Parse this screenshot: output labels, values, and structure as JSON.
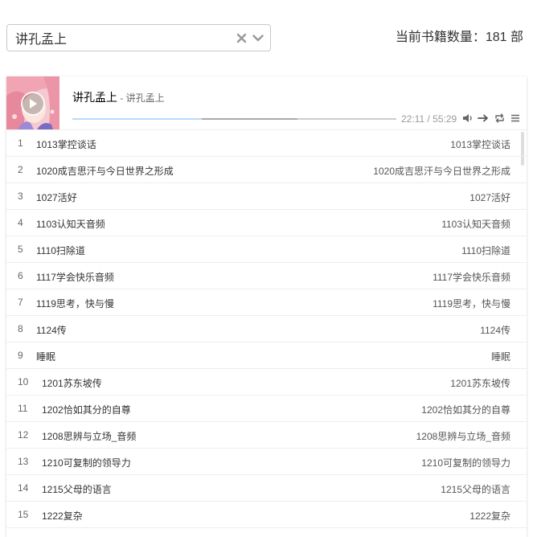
{
  "selector": {
    "value": "讲孔孟上"
  },
  "book_count": "当前书籍数量：181 部",
  "player": {
    "title": "讲孔孟上",
    "author_sep": " - ",
    "author": "讲孔孟上",
    "time": "22:11 / 55:29",
    "progress_played": 0.4,
    "progress_loaded": 0.696
  },
  "playlist": [
    {
      "index": "1",
      "name": "1013掌控谈话",
      "author": "1013掌控谈话"
    },
    {
      "index": "2",
      "name": "1020成吉思汗与今日世界之形成",
      "author": "1020成吉思汗与今日世界之形成"
    },
    {
      "index": "3",
      "name": "1027活好",
      "author": "1027活好"
    },
    {
      "index": "4",
      "name": "1103认知天音频",
      "author": "1103认知天音频"
    },
    {
      "index": "5",
      "name": "1110扫除道",
      "author": "1110扫除道"
    },
    {
      "index": "6",
      "name": "1117学会快乐音频",
      "author": "1117学会快乐音频"
    },
    {
      "index": "7",
      "name": "1119思考，快与慢",
      "author": "1119思考，快与慢"
    },
    {
      "index": "8",
      "name": "1124传",
      "author": "1124传"
    },
    {
      "index": "9",
      "name": "睡眠",
      "author": "睡眠"
    },
    {
      "index": "10",
      "name": "1201苏东坡传",
      "author": "1201苏东坡传"
    },
    {
      "index": "11",
      "name": "1202恰如其分的自尊",
      "author": "1202恰如其分的自尊"
    },
    {
      "index": "12",
      "name": "1208思辨与立场_音频",
      "author": "1208思辨与立场_音频"
    },
    {
      "index": "13",
      "name": "1210可复制的领导力",
      "author": "1210可复制的领导力"
    },
    {
      "index": "14",
      "name": "1215父母的语言",
      "author": "1215父母的语言"
    },
    {
      "index": "15",
      "name": "1222复杂",
      "author": "1222复杂"
    }
  ],
  "icons": {
    "clear": "close-icon",
    "dropdown": "chevron-down-icon",
    "play": "play-icon",
    "volume": "volume-icon",
    "order": "arrow-right-icon",
    "loop": "loop-icon",
    "menu": "menu-icon"
  },
  "colors": {
    "played": "#b7daff",
    "loaded": "#aaaaaa"
  }
}
